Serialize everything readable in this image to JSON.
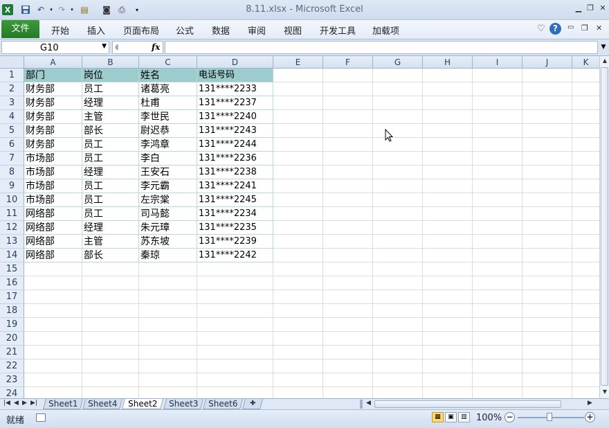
{
  "titlebar": {
    "title": "8.11.xlsx  -  Microsoft Excel",
    "quick_access": [
      "excel-logo-icon",
      "save-icon",
      "undo-icon",
      "redo-icon",
      "form-icon",
      "camera-icon",
      "print-preview-icon",
      "customize-icon"
    ]
  },
  "ribbon": {
    "file_tab": "文件",
    "tabs": [
      "开始",
      "插入",
      "页面布局",
      "公式",
      "数据",
      "审阅",
      "视图",
      "开发工具",
      "加载项"
    ]
  },
  "formula_bar": {
    "name_box": "G10",
    "fx": "fx",
    "formula": ""
  },
  "sheet": {
    "columns": [
      "A",
      "B",
      "C",
      "D",
      "E",
      "F",
      "G",
      "H",
      "I",
      "J",
      "K"
    ],
    "rows": [
      "1",
      "2",
      "3",
      "4",
      "5",
      "6",
      "7",
      "8",
      "9",
      "10",
      "11",
      "12",
      "13",
      "14",
      "15",
      "16",
      "17",
      "18",
      "19",
      "20",
      "21",
      "22",
      "23",
      "24"
    ],
    "header_fill": "#9ccccb",
    "table": [
      [
        "部门",
        "岗位",
        "姓名",
        "电话号码"
      ],
      [
        "财务部",
        "员工",
        "诸葛亮",
        "131****2233"
      ],
      [
        "财务部",
        "经理",
        "杜甫",
        "131****2237"
      ],
      [
        "财务部",
        "主管",
        "李世民",
        "131****2240"
      ],
      [
        "财务部",
        "部长",
        "尉迟恭",
        "131****2243"
      ],
      [
        "财务部",
        "员工",
        "李鸿章",
        "131****2244"
      ],
      [
        "市场部",
        "员工",
        "李白",
        "131****2236"
      ],
      [
        "市场部",
        "经理",
        "王安石",
        "131****2238"
      ],
      [
        "市场部",
        "员工",
        "李元霸",
        "131****2241"
      ],
      [
        "市场部",
        "员工",
        "左宗棠",
        "131****2245"
      ],
      [
        "网络部",
        "员工",
        "司马懿",
        "131****2234"
      ],
      [
        "网络部",
        "经理",
        "朱元璋",
        "131****2235"
      ],
      [
        "网络部",
        "主管",
        "苏东坡",
        "131****2239"
      ],
      [
        "网络部",
        "部长",
        "秦琼",
        "131****2242"
      ]
    ]
  },
  "sheet_tabs": {
    "tabs": [
      "Sheet1",
      "Sheet4",
      "Sheet2",
      "Sheet3",
      "Sheet6"
    ],
    "active": "Sheet2"
  },
  "status_bar": {
    "ready": "就绪",
    "zoom": "100%",
    "zoom_out": "−",
    "zoom_in": "+"
  }
}
